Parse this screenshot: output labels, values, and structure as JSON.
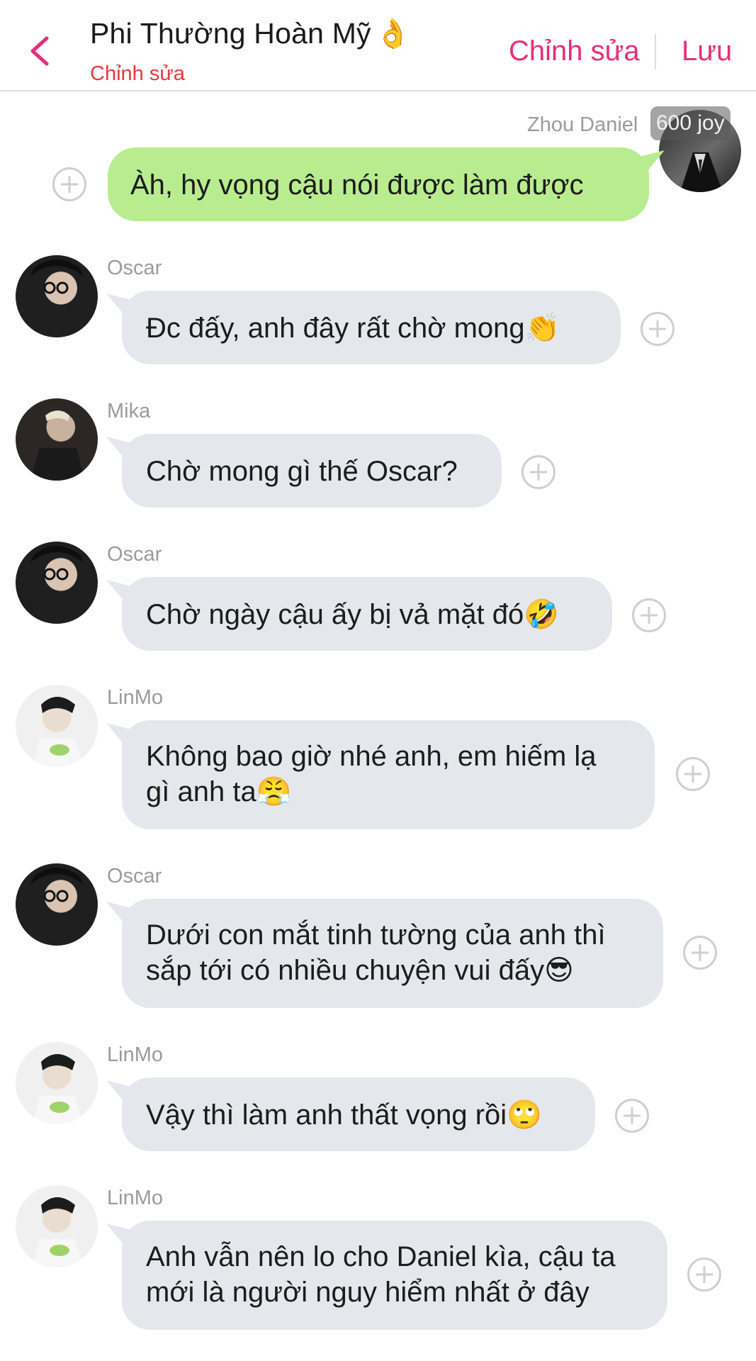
{
  "header": {
    "title": "Phi Thường Hoàn Mỹ",
    "title_emoji": "👌",
    "subtitle": "Chỉnh sửa",
    "edit_label": "Chỉnh sửa",
    "save_label": "Lưu",
    "back_icon": "chevron-left-icon",
    "accent_color": "#e62f7c"
  },
  "me": {
    "name": "Zhou Daniel",
    "badge": "600 joy",
    "message": "Àh, hy vọng cậu nói được làm được"
  },
  "messages": [
    {
      "sender": "Oscar",
      "text": "Đc đấy, anh đây rất chờ mong",
      "emoji": "👏"
    },
    {
      "sender": "Mika",
      "text": "Chờ mong gì thế Oscar?",
      "emoji": ""
    },
    {
      "sender": "Oscar",
      "text": "Chờ ngày cậu ấy bị vả mặt đó",
      "emoji": "🤣"
    },
    {
      "sender": "LinMo",
      "line1": "Không bao giờ nhé anh, em hiếm lạ",
      "line2": "gì anh ta",
      "emoji": "😤"
    },
    {
      "sender": "Oscar",
      "line1": "Dưới con mắt tinh tường của anh thì",
      "line2": "sắp tới có nhiều chuyện vui đấy",
      "emoji": "😎"
    },
    {
      "sender": "LinMo",
      "text": "Vậy thì làm anh thất vọng rồi",
      "emoji": "🙄"
    },
    {
      "sender": "LinMo",
      "line1": "Anh vẫn nên lo cho Daniel kìa, cậu ta",
      "line2": "mới là người nguy hiểm nhất ở đây"
    }
  ],
  "colors": {
    "bubble_other": "#e4e8ec",
    "bubble_me": "#b9ec8f",
    "subtitle": "#e8383d"
  }
}
